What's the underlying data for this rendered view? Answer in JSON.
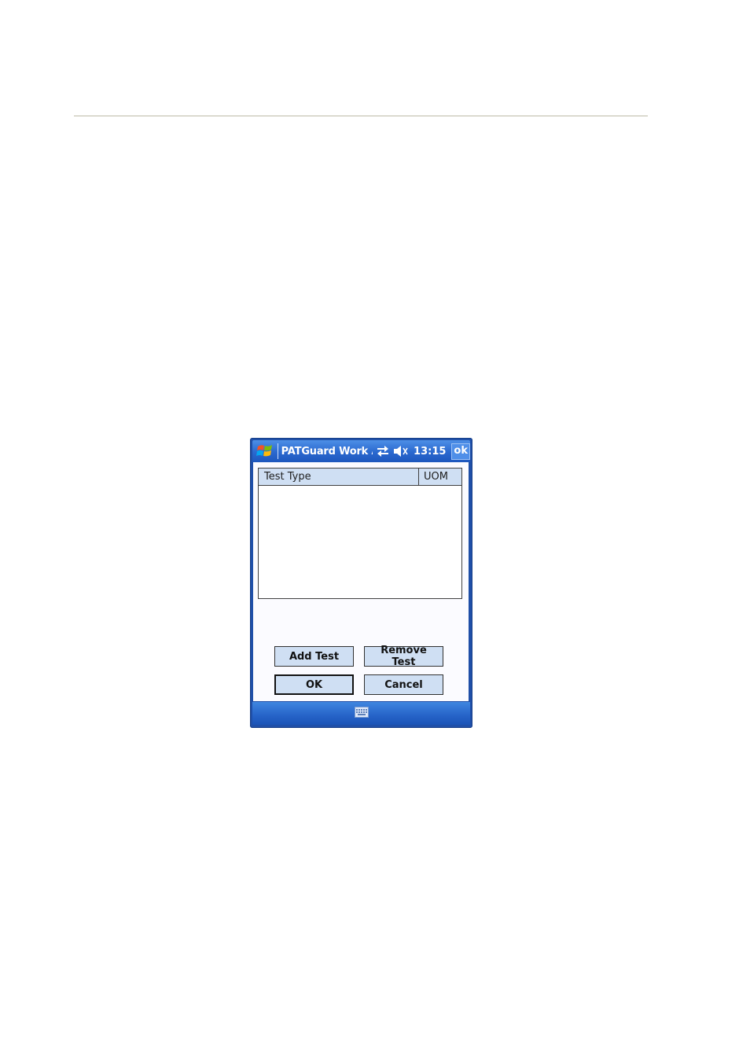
{
  "titlebar": {
    "app_title": "PATGuard Work Al",
    "clock": "13:15",
    "ok_label": "ok",
    "icons": [
      "windows-start-icon",
      "connectivity-icon",
      "speaker-muted-icon"
    ]
  },
  "listview": {
    "columns": [
      "Test Type",
      "UOM"
    ],
    "rows": []
  },
  "buttons": {
    "add_test": "Add Test",
    "remove_test": "Remove Test",
    "ok": "OK",
    "cancel": "Cancel"
  },
  "menubar": {
    "icons": [
      "keyboard-icon"
    ]
  },
  "colors": {
    "title_bar": "#2a68cf",
    "button_face": "#cfdff3",
    "header_face": "#cfdff3"
  }
}
